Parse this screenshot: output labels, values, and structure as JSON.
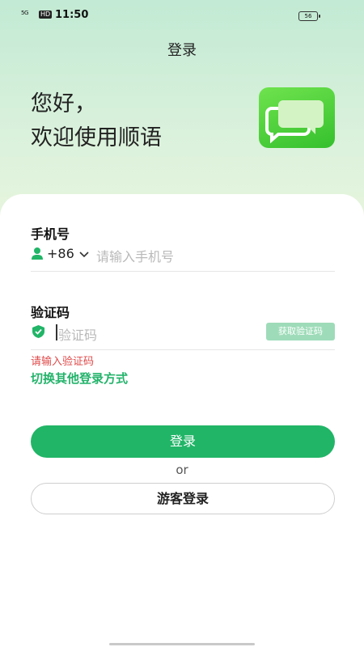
{
  "status_bar": {
    "signal": "5G",
    "network_badge": "HD",
    "time": "11:50",
    "battery": "56"
  },
  "header": {
    "title": "登录"
  },
  "hero": {
    "line1": "您好，",
    "line2": "欢迎使用顺语"
  },
  "form": {
    "phone_label": "手机号",
    "country_code": "+86",
    "phone_placeholder": "请输入手机号",
    "code_label": "验证码",
    "code_placeholder": "验证码",
    "get_code_label": "获取验证码",
    "error_text": "请输入验证码",
    "switch_login": "切换其他登录方式"
  },
  "actions": {
    "login_label": "登录",
    "or_text": "or",
    "guest_label": "游客登录"
  },
  "colors": {
    "primary": "#21b567",
    "error": "#e04a4a"
  }
}
